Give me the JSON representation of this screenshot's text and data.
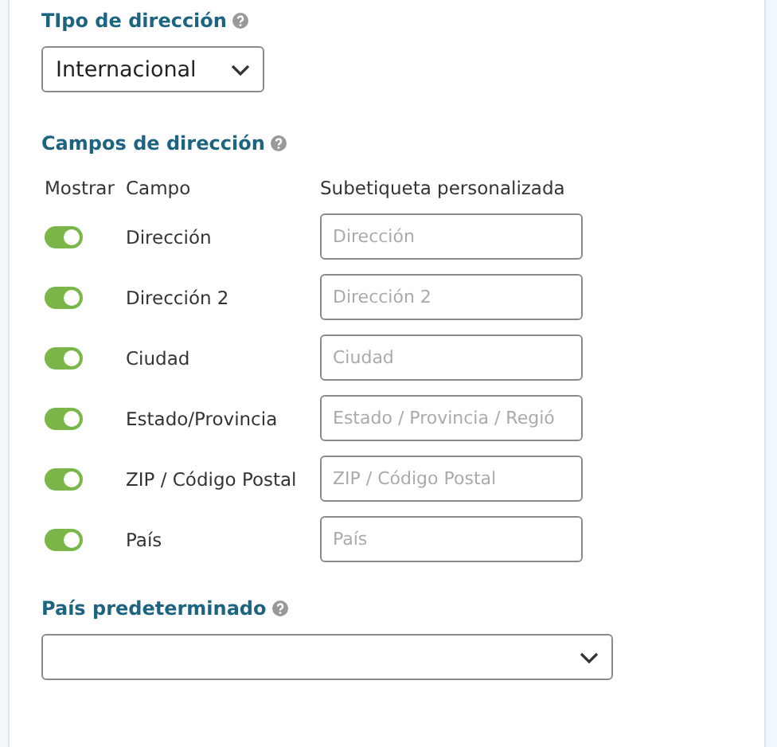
{
  "address_type": {
    "label": "TIpo de dirección",
    "value": "Internacional"
  },
  "address_fields": {
    "label": "Campos de dirección",
    "columns": [
      "Mostrar",
      "Campo",
      "Subetiqueta personalizada"
    ],
    "rows": [
      {
        "on": true,
        "name": "Dirección",
        "placeholder": "Dirección"
      },
      {
        "on": true,
        "name": "Dirección 2",
        "placeholder": "Dirección 2"
      },
      {
        "on": true,
        "name": "Ciudad",
        "placeholder": "Ciudad"
      },
      {
        "on": true,
        "name": "Estado/Provincia",
        "placeholder": "Estado / Provincia / Regió"
      },
      {
        "on": true,
        "name": "ZIP / Código Postal",
        "placeholder": "ZIP / Código Postal"
      },
      {
        "on": true,
        "name": "País",
        "placeholder": "País"
      }
    ]
  },
  "default_country": {
    "label": "País predeterminado"
  }
}
